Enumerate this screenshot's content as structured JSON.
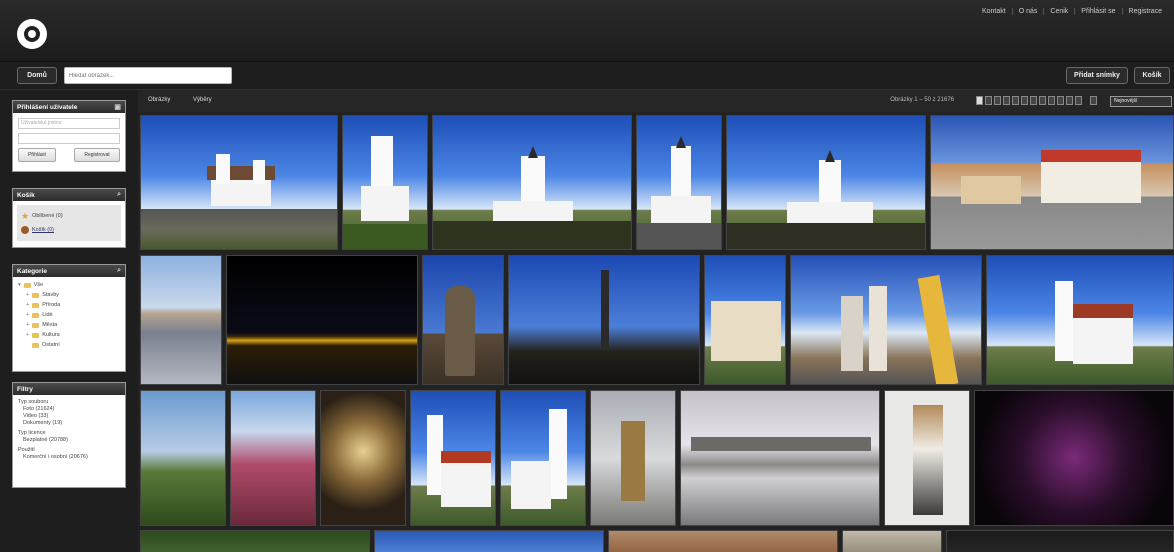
{
  "header": {
    "logo_icon": "camera-aperture-icon",
    "top_links": [
      "Kontakt",
      "O nás",
      "Cenik",
      "Přihlásit se",
      "Registrace"
    ]
  },
  "search": {
    "home_label": "Domů",
    "placeholder": "Hledat obrázek...",
    "right_button_1": "Přidat snímky",
    "right_button_2": "Košík"
  },
  "sidebar": {
    "login": {
      "title": "Přihlášení uživatele",
      "field_placeholder": "Uživatelské jméno",
      "btn_login": "Přihlásit",
      "btn_register": "Registrovat"
    },
    "cart": {
      "title": "Košík",
      "items": [
        "Oblíbené (0)",
        "Košík (0)"
      ]
    },
    "categories": {
      "title": "Kategorie",
      "items": [
        "Vše",
        "Stavby",
        "Příroda",
        "Lidé",
        "Města",
        "Kultura",
        "Ostatní"
      ]
    },
    "filters": {
      "title": "Filtry",
      "groups": [
        {
          "heading": "Typ souboru",
          "lines": [
            "Foto (21624)",
            "Video (33)",
            "Dokumenty (19)"
          ]
        },
        {
          "heading": "Typ licence",
          "lines": [
            "Bezplatné (20788)"
          ]
        },
        {
          "heading": "Použití",
          "lines": [
            "Komerční i osobní (20676)"
          ]
        }
      ]
    }
  },
  "toolbar": {
    "tab_1": "Obrázky",
    "tab_2": "Výběry",
    "pager_text": "Obrázky 1 – 50 z 21676",
    "sort_label": "Nejnovější"
  }
}
